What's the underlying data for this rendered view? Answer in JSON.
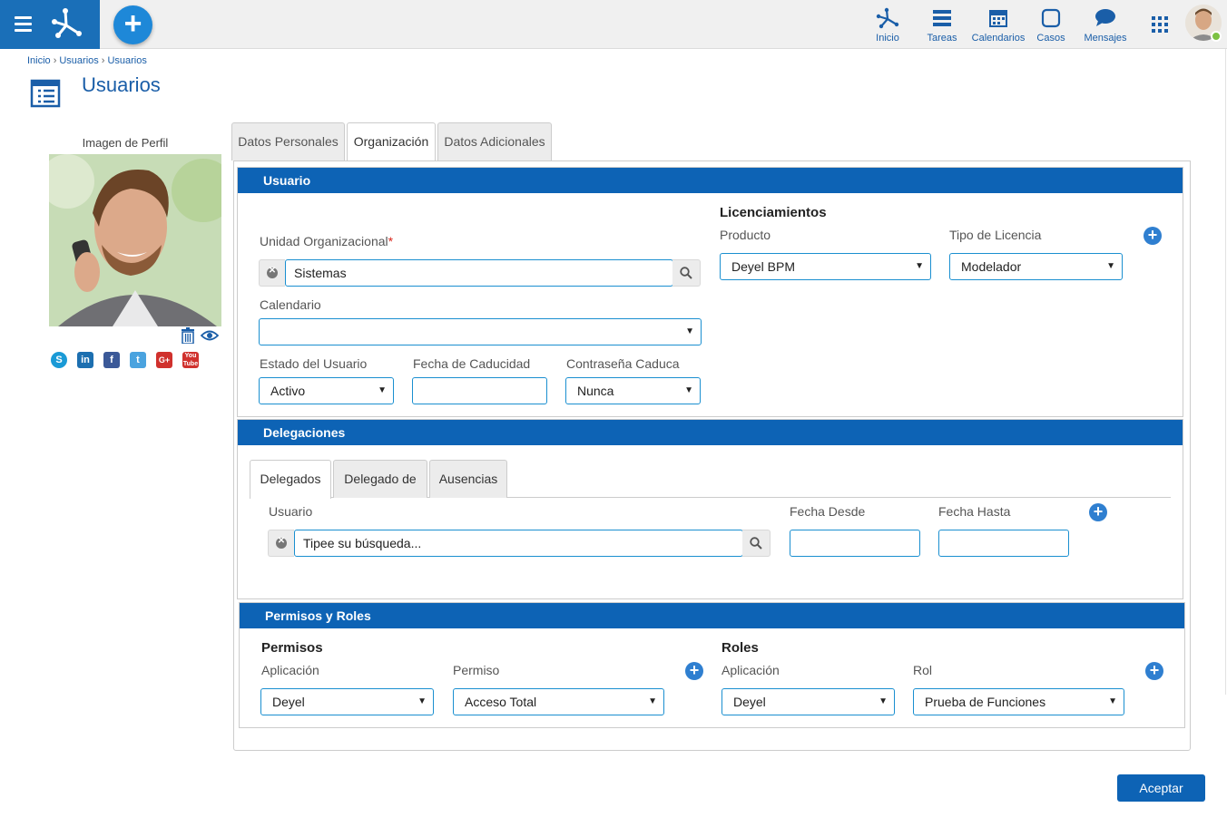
{
  "header": {
    "nav": [
      {
        "label": "Inicio",
        "icon": "workflow-icon"
      },
      {
        "label": "Tareas",
        "icon": "tasks-icon"
      },
      {
        "label": "Calendarios",
        "icon": "calendar-icon"
      },
      {
        "label": "Casos",
        "icon": "cases-icon"
      },
      {
        "label": "Mensajes",
        "icon": "messages-icon"
      }
    ]
  },
  "breadcrumb": [
    "Inicio",
    "Usuarios",
    "Usuarios"
  ],
  "page": {
    "title": "Usuarios"
  },
  "profile": {
    "label": "Imagen de Perfil"
  },
  "tabs": [
    "Datos Personales",
    "Organización",
    "Datos Adicionales"
  ],
  "usuario": {
    "header": "Usuario",
    "unidad_label": "Unidad Organizacional",
    "unidad_required": "*",
    "unidad_value": "Sistemas",
    "calendario_label": "Calendario",
    "calendario_value": "",
    "estado_label": "Estado del Usuario",
    "estado_value": "Activo",
    "caducidad_label": "Fecha de Caducidad",
    "caducidad_value": "",
    "contrasena_label": "Contraseña Caduca",
    "contrasena_value": "Nunca",
    "licencias_heading": "Licenciamientos",
    "producto_label": "Producto",
    "producto_value": "Deyel BPM",
    "tipo_label": "Tipo de Licencia",
    "tipo_value": "Modelador"
  },
  "delegaciones": {
    "header": "Delegaciones",
    "subtabs": [
      "Delegados",
      "Delegado de",
      "Ausencias"
    ],
    "usuario_label": "Usuario",
    "usuario_placeholder": "Tipee su búsqueda...",
    "desde_label": "Fecha Desde",
    "hasta_label": "Fecha Hasta"
  },
  "permisos": {
    "header": "Permisos y Roles",
    "permisos_heading": "Permisos",
    "aplicacion_label": "Aplicación",
    "aplicacion_value": "Deyel",
    "permiso_label": "Permiso",
    "permiso_value": "Acceso Total",
    "roles_heading": "Roles",
    "roles_aplicacion_label": "Aplicación",
    "roles_aplicacion_value": "Deyel",
    "rol_label": "Rol",
    "rol_value": "Prueba de Funciones"
  },
  "footer": {
    "accept_label": "Aceptar"
  },
  "colors": {
    "primary": "#0d63b5",
    "accent": "#1e88d8",
    "online": "#7cc142"
  }
}
